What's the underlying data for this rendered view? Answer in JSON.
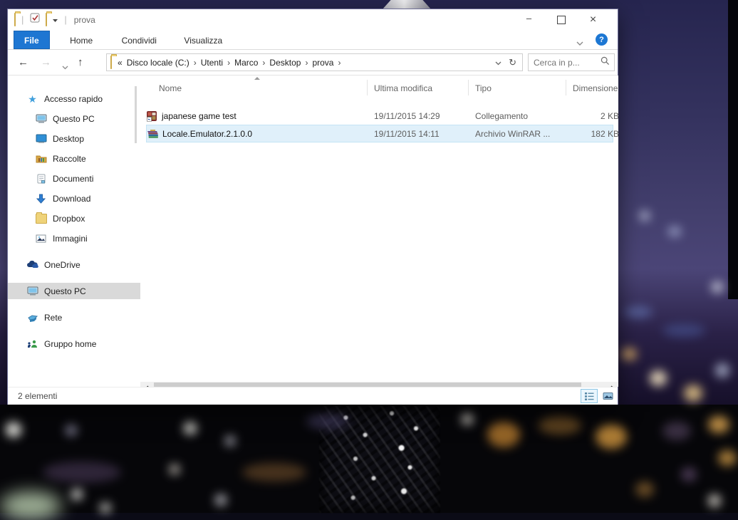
{
  "titlebar": {
    "title": "prova",
    "separator": "|",
    "minimize_glyph": "–",
    "close_glyph": "×"
  },
  "ribbon": {
    "tabs": [
      {
        "label": "File"
      },
      {
        "label": "Home"
      },
      {
        "label": "Condividi"
      },
      {
        "label": "Visualizza"
      }
    ],
    "help_glyph": "?"
  },
  "navbar": {
    "back_glyph": "←",
    "forward_glyph": "→",
    "up_glyph": "↑",
    "refresh_glyph": "↻",
    "breadcrumb": {
      "overflow_glyph": "«",
      "separator": "›",
      "segments": [
        "Disco locale (C:)",
        "Utenti",
        "Marco",
        "Desktop",
        "prova"
      ]
    },
    "search_placeholder": "Cerca in p..."
  },
  "sidebar": {
    "items": [
      {
        "label": "Accesso rapido"
      },
      {
        "label": "Questo PC"
      },
      {
        "label": "Desktop"
      },
      {
        "label": "Raccolte"
      },
      {
        "label": "Documenti"
      },
      {
        "label": "Download"
      },
      {
        "label": "Dropbox"
      },
      {
        "label": "Immagini"
      },
      {
        "label": "OneDrive"
      },
      {
        "label": "Questo PC"
      },
      {
        "label": "Rete"
      },
      {
        "label": "Gruppo home"
      }
    ]
  },
  "file_list": {
    "columns": [
      {
        "label": "Nome"
      },
      {
        "label": "Ultima modifica"
      },
      {
        "label": "Tipo"
      },
      {
        "label": "Dimensione"
      }
    ],
    "rows": [
      {
        "name": "japanese game test",
        "modified": "19/11/2015 14:29",
        "type": "Collegamento",
        "size": "2 KB"
      },
      {
        "name": "Locale.Emulator.2.1.0.0",
        "modified": "19/11/2015 14:11",
        "type": "Archivio WinRAR ...",
        "size": "182 KB"
      }
    ]
  },
  "statusbar": {
    "count": "2 elementi"
  },
  "colors": {
    "accent_blue": "#1e76d2",
    "help_blue": "#1d77d3",
    "row_selection": "#e0f0fa",
    "sidebar_selection": "#d9d9d9"
  }
}
